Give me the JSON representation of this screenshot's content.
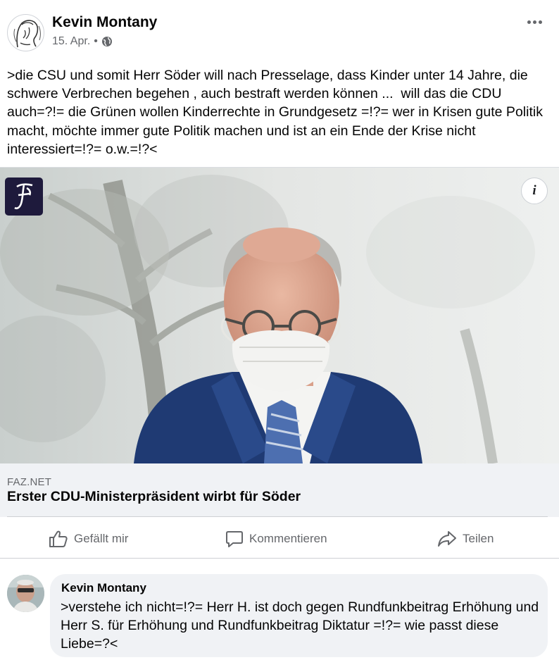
{
  "post": {
    "author": "Kevin Montany",
    "date": "15. Apr.",
    "separator": "•",
    "privacy_icon": "globe-icon",
    "more_icon": "more-options-icon",
    "text": ">die CSU und somit Herr Söder will nach Presselage, dass Kinder unter 14 Jahre, die schwere Verbrechen begehen , auch bestraft werden können ...  will das die CDU auch=?!= die Grünen wollen Kinderrechte in Grundgesetz =!?= wer in Krisen gute Politik macht, möchte immer gute Politik machen und ist an ein Ende der Krise nicht interessiert=!?= o.w.=!?<"
  },
  "link_preview": {
    "publisher_logo_letter": "F",
    "info_label": "i",
    "source": "FAZ.NET",
    "title": "Erster CDU-Ministerpräsident wirbt für Söder"
  },
  "actions": {
    "like": "Gefällt mir",
    "comment": "Kommentieren",
    "share": "Teilen"
  },
  "comment": {
    "author": "Kevin Montany",
    "text": ">verstehe ich nicht=!?= Herr H. ist doch gegen Rundfunkbeitrag Erhöhung und Herr S. für Erhöhung und Rundfunkbeitrag Diktatur =!?= wie passt diese Liebe=?<"
  },
  "colors": {
    "secondary_text": "#65676b",
    "card_background": "#f0f2f5",
    "logo_background": "#1e1a3c",
    "suit": "#1f3a73"
  }
}
